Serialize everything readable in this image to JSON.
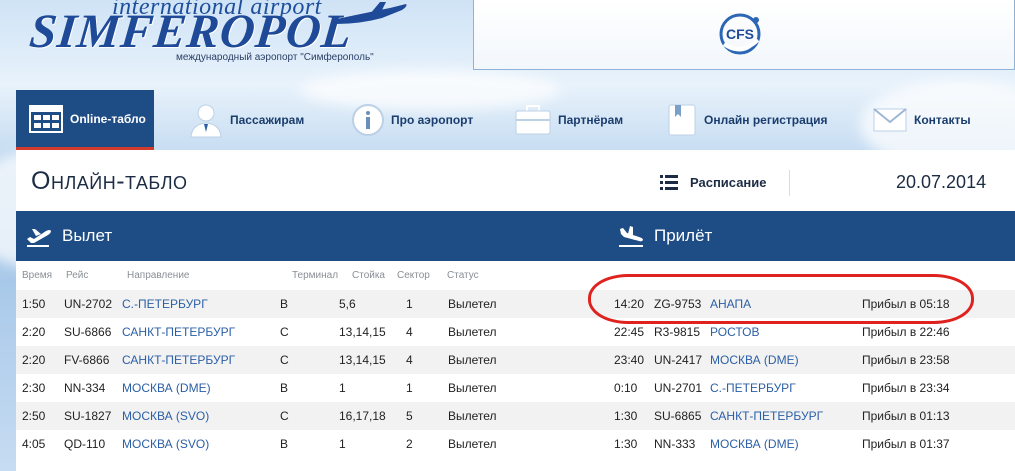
{
  "header": {
    "logo_top": "international airport",
    "logo_main": "SIMFEROPOL",
    "logo_sub": "международный аэропорт \"Симферополь\"",
    "banner_logo": "CFS"
  },
  "nav": {
    "items": [
      {
        "label": "Online-табло",
        "icon": "board-icon"
      },
      {
        "label": "Пассажирам",
        "icon": "passenger-icon"
      },
      {
        "label": "Про аэропорт",
        "icon": "info-icon"
      },
      {
        "label": "Партнёрам",
        "icon": "briefcase-icon"
      },
      {
        "label": "Онлайн регистрация",
        "icon": "book-icon"
      },
      {
        "label": "Контакты",
        "icon": "mail-icon"
      }
    ]
  },
  "board": {
    "title": "Онлайн-табло",
    "schedule_label": "Расписание",
    "date": "20.07.2014",
    "departures_title": "Вылет",
    "arrivals_title": "Прилёт"
  },
  "departures": {
    "columns": [
      "Время",
      "Рейс",
      "Направление",
      "Терминал",
      "Стойка",
      "Сектор",
      "Статус"
    ],
    "rows": [
      {
        "time": "1:50",
        "flight": "UN-2702",
        "dest": "С.-ПЕТЕРБУРГ",
        "terminal": "B",
        "desk": "5,6",
        "sector": "1",
        "status": "Вылетел"
      },
      {
        "time": "2:20",
        "flight": "SU-6866",
        "dest": "САНКТ-ПЕТЕРБУРГ",
        "terminal": "C",
        "desk": "13,14,15",
        "sector": "4",
        "status": "Вылетел"
      },
      {
        "time": "2:20",
        "flight": "FV-6866",
        "dest": "САНКТ-ПЕТЕРБУРГ",
        "terminal": "C",
        "desk": "13,14,15",
        "sector": "4",
        "status": "Вылетел"
      },
      {
        "time": "2:30",
        "flight": "NN-334",
        "dest": "МОСКВА (DME)",
        "terminal": "B",
        "desk": "1",
        "sector": "1",
        "status": "Вылетел"
      },
      {
        "time": "2:50",
        "flight": "SU-1827",
        "dest": "МОСКВА (SVO)",
        "terminal": "C",
        "desk": "16,17,18",
        "sector": "5",
        "status": "Вылетел"
      },
      {
        "time": "4:05",
        "flight": "QD-110",
        "dest": "МОСКВА (SVO)",
        "terminal": "B",
        "desk": "1",
        "sector": "2",
        "status": "Вылетел"
      }
    ]
  },
  "arrivals": {
    "rows": [
      {
        "time": "14:20",
        "flight": "ZG-9753",
        "origin": "АНАПА",
        "status": "Прибыл в 05:18"
      },
      {
        "time": "22:45",
        "flight": "R3-9815",
        "origin": "РОСТОВ",
        "status": "Прибыл в 22:46"
      },
      {
        "time": "23:40",
        "flight": "UN-2417",
        "origin": "МОСКВА (DME)",
        "status": "Прибыл в 23:58"
      },
      {
        "time": "0:10",
        "flight": "UN-2701",
        "origin": "С.-ПЕТЕРБУРГ",
        "status": "Прибыл в 23:34"
      },
      {
        "time": "1:30",
        "flight": "SU-6865",
        "origin": "САНКТ-ПЕТЕРБУРГ",
        "status": "Прибыл в 01:13"
      },
      {
        "time": "1:30",
        "flight": "NN-333",
        "origin": "МОСКВА (DME)",
        "status": "Прибыл в 01:37"
      }
    ]
  },
  "colors": {
    "nav_active": "#1e4d86",
    "board_bar": "#1e4d86",
    "link": "#2b5fa6",
    "highlight_circle": "#e0221e"
  }
}
